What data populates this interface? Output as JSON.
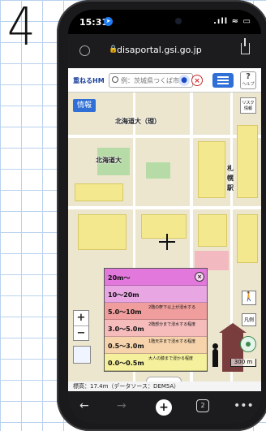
{
  "annotation": {
    "number": "4"
  },
  "status_bar": {
    "time": "15:31",
    "signal": ".ıll ≈",
    "battery": "▭"
  },
  "browser": {
    "url": "disaportal.gsi.go.jp"
  },
  "app_header": {
    "brand": "重ねるHM",
    "search_placeholder": "例：茨城県つくば市",
    "help_label": "?",
    "help_sub": "ヘルプ"
  },
  "map": {
    "info_button": "情報",
    "risk_button": "リスク情報",
    "labels": [
      {
        "text": "北海道大（理）"
      },
      {
        "text": "北海道大"
      },
      {
        "text": "札"
      },
      {
        "text": "幌"
      },
      {
        "text": "駅"
      }
    ],
    "zoom_in": "+",
    "zoom_out": "−",
    "legend_button": "凡例",
    "scale": "300 m",
    "elevation": "標高：17.4m（データソース：DEM5A）"
  },
  "legend": {
    "rows": [
      {
        "depth": "20m〜",
        "desc": "",
        "color": "#e277dc"
      },
      {
        "depth": "10〜20m",
        "desc": "",
        "color": "#e8a7e3"
      },
      {
        "depth": "5.0〜10m",
        "desc": "2階の軒下以上が浸水する",
        "color": "#f09d9d"
      },
      {
        "depth": "3.0〜5.0m",
        "desc": "2階部分まで浸水する程度",
        "color": "#f6bcbc"
      },
      {
        "depth": "0.5〜3.0m",
        "desc": "1階天井まで浸水する程度",
        "color": "#f6d3ab"
      },
      {
        "depth": "0.0〜0.5m",
        "desc": "大人の膝まで浸かる程度",
        "color": "#f5f09c"
      }
    ],
    "close_icon": "×"
  },
  "toolbar": {
    "back": "←",
    "forward": "→",
    "new": "+",
    "tabs": "2",
    "more": "•••"
  }
}
